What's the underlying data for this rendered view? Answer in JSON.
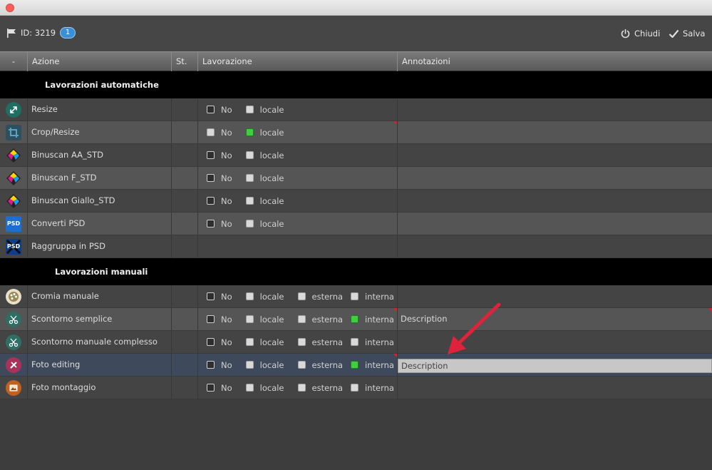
{
  "window": {
    "close_color": "#fc5f57"
  },
  "toolbar": {
    "id_label": "ID: 3219",
    "badge": "1",
    "close_label": "Chiudi",
    "save_label": "Salva"
  },
  "columns": [
    "-",
    "Azione",
    "St.",
    "Lavorazione",
    "Annotazioni"
  ],
  "sections": [
    {
      "title": "Lavorazioni automatiche",
      "rows": [
        {
          "icon": "resize-icon",
          "action": "Resize",
          "options": [
            {
              "label": "No",
              "checked": false,
              "style": "square"
            },
            {
              "label": "locale",
              "checked": false
            }
          ],
          "annotation": "",
          "marker": false
        },
        {
          "icon": "crop-icon",
          "action": "Crop/Resize",
          "options": [
            {
              "label": "No",
              "checked": false
            },
            {
              "label": "locale",
              "checked": true
            }
          ],
          "annotation": "",
          "marker": true
        },
        {
          "icon": "binuscan-icon",
          "action": "Binuscan AA_STD",
          "options": [
            {
              "label": "No",
              "checked": false,
              "style": "square"
            },
            {
              "label": "locale",
              "checked": false
            }
          ],
          "annotation": "",
          "marker": false
        },
        {
          "icon": "binuscan-icon",
          "action": "Binuscan F_STD",
          "options": [
            {
              "label": "No",
              "checked": false,
              "style": "square"
            },
            {
              "label": "locale",
              "checked": false
            }
          ],
          "annotation": "",
          "marker": false
        },
        {
          "icon": "binuscan-icon",
          "action": "Binuscan Giallo_STD",
          "options": [
            {
              "label": "No",
              "checked": false,
              "style": "square"
            },
            {
              "label": "locale",
              "checked": false
            }
          ],
          "annotation": "",
          "marker": false
        },
        {
          "icon": "psd-icon",
          "action": "Converti PSD",
          "options": [
            {
              "label": "No",
              "checked": false,
              "style": "square"
            },
            {
              "label": "locale",
              "checked": false
            }
          ],
          "annotation": "",
          "marker": false
        },
        {
          "icon": "psd-group-icon",
          "action": "Raggruppa in PSD",
          "options": [],
          "annotation": "",
          "marker": false
        }
      ]
    },
    {
      "title": "Lavorazioni manuali",
      "rows": [
        {
          "icon": "palette-icon",
          "action": "Cromia manuale",
          "options": [
            {
              "label": "No",
              "checked": false,
              "style": "square"
            },
            {
              "label": "locale",
              "checked": false
            },
            {
              "label": "esterna",
              "checked": false
            },
            {
              "label": "interna",
              "checked": false
            }
          ],
          "annotation": "",
          "marker": false
        },
        {
          "icon": "scissors-icon",
          "action": "Scontorno semplice",
          "options": [
            {
              "label": "No",
              "checked": false,
              "style": "square"
            },
            {
              "label": "locale",
              "checked": false
            },
            {
              "label": "esterna",
              "checked": false
            },
            {
              "label": "interna",
              "checked": true
            }
          ],
          "annotation": "Description",
          "marker": true
        },
        {
          "icon": "scissors-icon",
          "action": "Scontorno manuale complesso",
          "options": [
            {
              "label": "No",
              "checked": false,
              "style": "square"
            },
            {
              "label": "locale",
              "checked": false
            },
            {
              "label": "esterna",
              "checked": false
            },
            {
              "label": "interna",
              "checked": false
            }
          ],
          "annotation": "",
          "marker": false
        },
        {
          "icon": "photo-edit-icon",
          "action": "Foto editing",
          "options": [
            {
              "label": "No",
              "checked": false,
              "style": "square"
            },
            {
              "label": "locale",
              "checked": false
            },
            {
              "label": "esterna",
              "checked": false
            },
            {
              "label": "interna",
              "checked": true
            }
          ],
          "annotation": "Description",
          "marker": true,
          "selected": true,
          "editing": true
        },
        {
          "icon": "photo-montage-icon",
          "action": "Foto montaggio",
          "options": [
            {
              "label": "No",
              "checked": false,
              "style": "square"
            },
            {
              "label": "locale",
              "checked": false
            },
            {
              "label": "esterna",
              "checked": false
            },
            {
              "label": "interna",
              "checked": false
            }
          ],
          "annotation": "",
          "marker": false
        }
      ]
    }
  ],
  "colors": {
    "checked": "#3fcf3f",
    "marker": "#d8232a",
    "arrow": "#e0233a",
    "badge": "#3a8fd6"
  }
}
